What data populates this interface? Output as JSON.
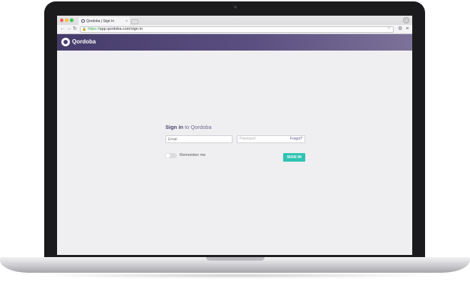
{
  "browser": {
    "tab_title": "Qordoba | Sign In",
    "url_scheme": "https://",
    "url_rest": "app.qordoba.com/sign-in"
  },
  "app": {
    "logo_text": "Qordoba"
  },
  "signin": {
    "title_strong": "Sign in",
    "title_rest": " to Qordoba",
    "email_placeholder": "Email",
    "password_placeholder": "Password",
    "forgot_label": "Forgot?",
    "remember_label": "Remember me",
    "remember_checked": false,
    "button_label": "SIGN IN"
  },
  "colors": {
    "header": "#4a3f6e",
    "accent_button": "#2fc3b3"
  }
}
